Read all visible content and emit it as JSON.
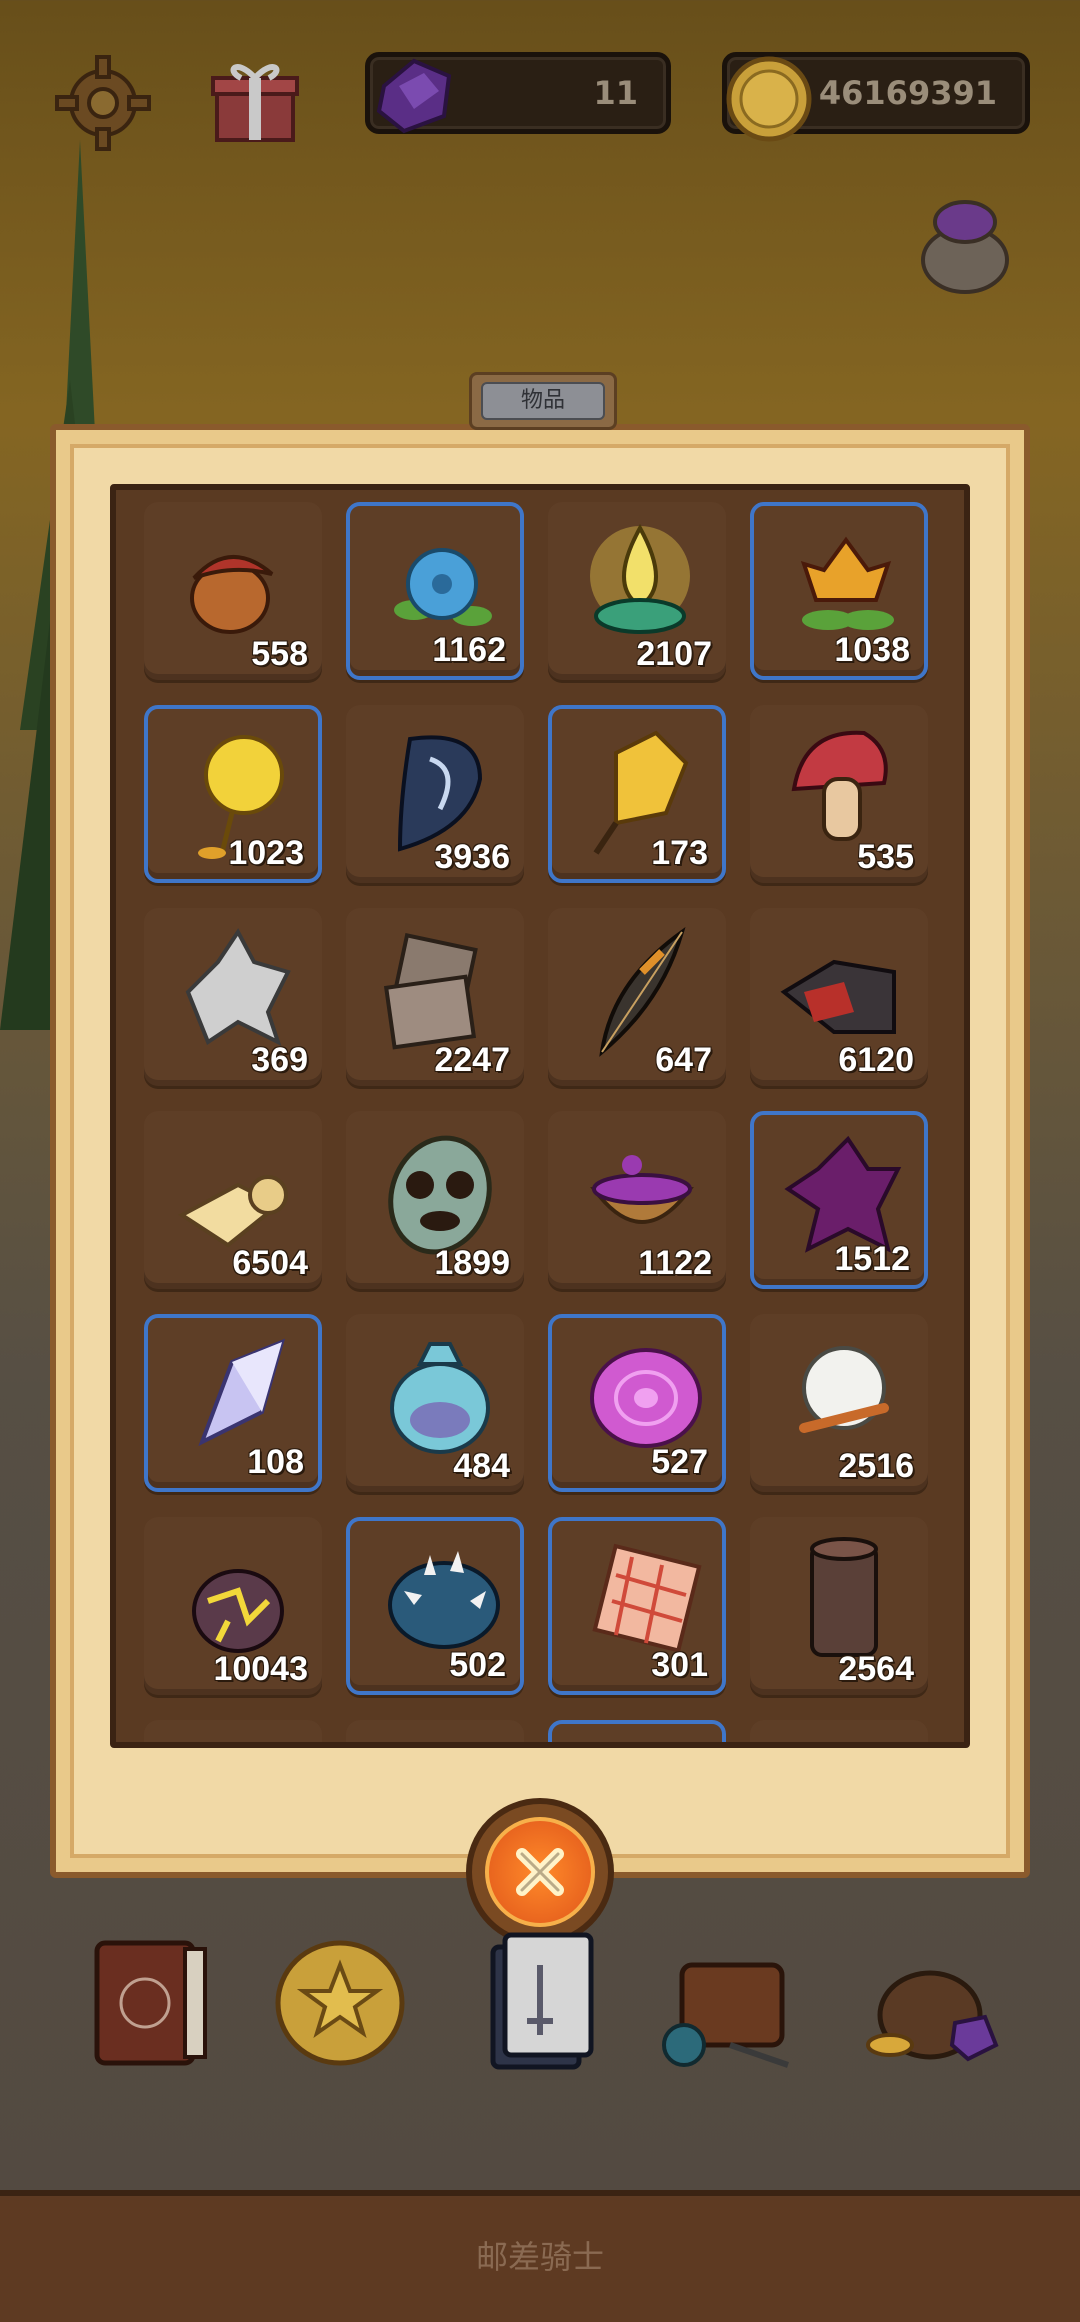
{
  "hud": {
    "gems": "11",
    "coins": "46169391"
  },
  "panel": {
    "title": "物品"
  },
  "items": [
    {
      "count": "558",
      "icon": "acorn-icon",
      "selected": false
    },
    {
      "count": "1162",
      "icon": "blue-flower-icon",
      "selected": true
    },
    {
      "count": "2107",
      "icon": "glowing-lotus-icon",
      "selected": false
    },
    {
      "count": "1038",
      "icon": "fire-flower-icon",
      "selected": true
    },
    {
      "count": "1023",
      "icon": "dandelion-icon",
      "selected": true
    },
    {
      "count": "3936",
      "icon": "dark-leaf-icon",
      "selected": false
    },
    {
      "count": "173",
      "icon": "golden-leaf-icon",
      "selected": true
    },
    {
      "count": "535",
      "icon": "mushroom-icon",
      "selected": false
    },
    {
      "count": "369",
      "icon": "grey-pelt-icon",
      "selected": false
    },
    {
      "count": "2247",
      "icon": "cloth-scraps-icon",
      "selected": false
    },
    {
      "count": "647",
      "icon": "feather-icon",
      "selected": false
    },
    {
      "count": "6120",
      "icon": "red-cloth-icon",
      "selected": false
    },
    {
      "count": "6504",
      "icon": "parchment-icon",
      "selected": false
    },
    {
      "count": "1899",
      "icon": "turtle-shell-icon",
      "selected": false
    },
    {
      "count": "1122",
      "icon": "potion-bowl-icon",
      "selected": false
    },
    {
      "count": "1512",
      "icon": "purple-hide-icon",
      "selected": true
    },
    {
      "count": "108",
      "icon": "crystal-shard-icon",
      "selected": true
    },
    {
      "count": "484",
      "icon": "blue-pouch-icon",
      "selected": false
    },
    {
      "count": "527",
      "icon": "pink-orb-icon",
      "selected": true
    },
    {
      "count": "2516",
      "icon": "fluff-icon",
      "selected": false
    },
    {
      "count": "10043",
      "icon": "lava-stone-icon",
      "selected": false
    },
    {
      "count": "502",
      "icon": "spiked-shell-icon",
      "selected": true
    },
    {
      "count": "301",
      "icon": "plaid-cloth-icon",
      "selected": true
    },
    {
      "count": "2564",
      "icon": "wood-log-icon",
      "selected": false
    }
  ],
  "footer": {
    "game_title": "邮差骑士"
  },
  "colors": {
    "selected_border": "#3f76c9",
    "cell_bg": "#5e3e26",
    "panel_bg": "#f1d9a6"
  }
}
